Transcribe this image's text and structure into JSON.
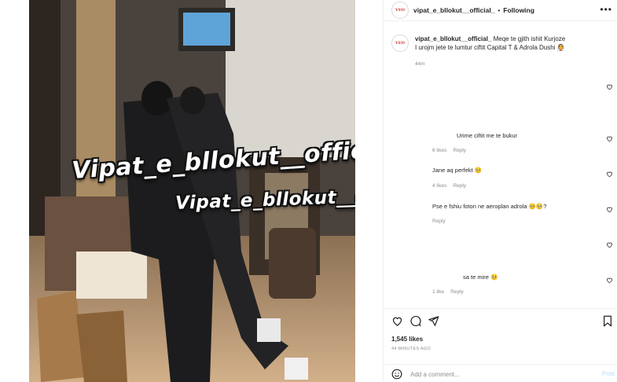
{
  "post": {
    "username": "vipat_e_bllokut__official_",
    "separator": "•",
    "follow_status": "Following",
    "more_label": "•••",
    "avatar_logo": "VEO",
    "watermark_line1": "Vipat_e_bllokut__official_",
    "watermark_line2": "Vipat_e_bllokut__official_"
  },
  "caption": {
    "username": "vipat_e_bllokut__official_",
    "text_line1": "Meqe te gjith ishit Kurjoze",
    "text_line2": "I urojm jete te lumtur ciftit Capital T & Adrola Dushi 👰",
    "time": "44m"
  },
  "comments": [
    {
      "text": "Urime ciftit me te bukur",
      "likes": "6 likes",
      "reply": "Reply"
    },
    {
      "text": "Jane aq perfekt 🥺",
      "likes": "4 likes",
      "reply": "Reply"
    },
    {
      "text": "Pse e fshiu foton ne aeroplan adrola 🥺🥺?",
      "likes": "",
      "reply": "Reply"
    },
    {
      "text": "sa te mire 🥺",
      "likes": "1 like",
      "reply": "Reply"
    }
  ],
  "footer": {
    "likes": "1,545 likes",
    "ago": "44 MINUTES AGO",
    "add_comment_placeholder": "Add a comment...",
    "post_label": "Post"
  },
  "icons": [
    "more-icon",
    "heart-icon",
    "comment-icon",
    "share-icon",
    "bookmark-icon",
    "emoji-icon"
  ],
  "colors": {
    "accent_blue_disabled": "#b2dffc",
    "muted": "#8e8e8e",
    "text": "#262626"
  }
}
